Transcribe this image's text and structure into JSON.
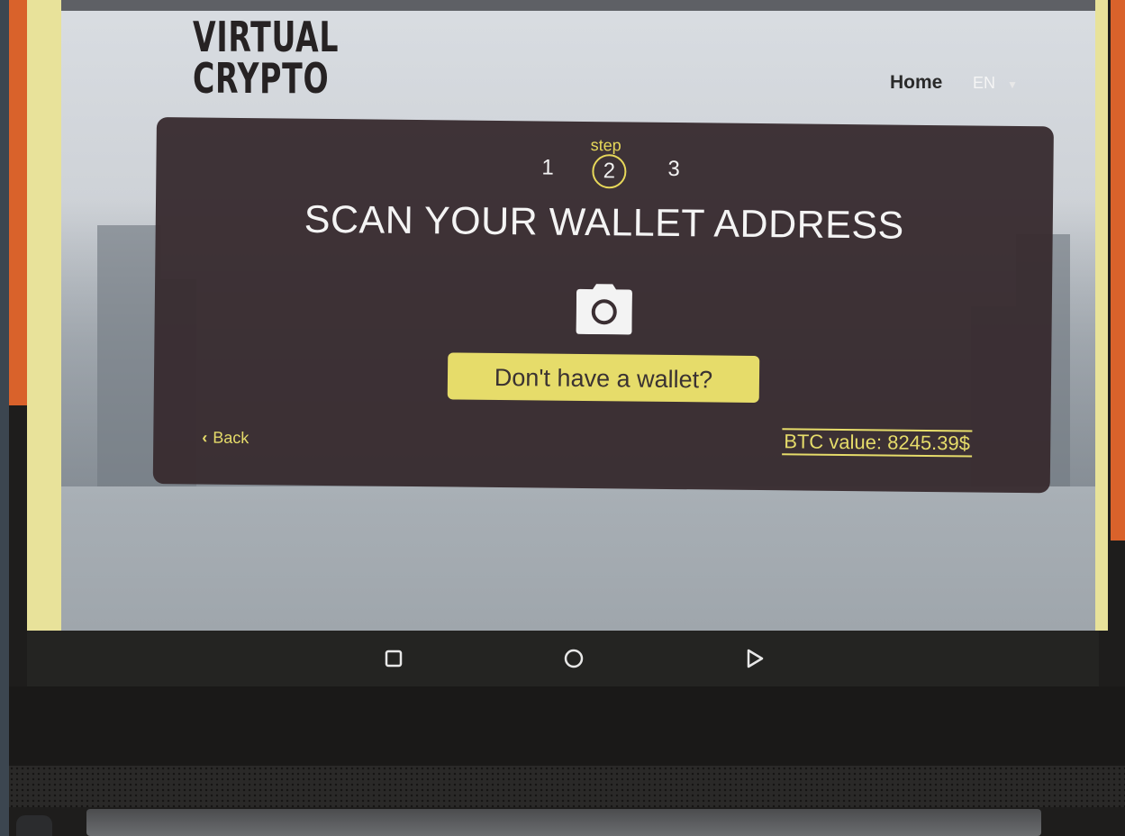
{
  "brand": {
    "logo_line1": "VIRTUAL",
    "logo_line2": "CRYPTO"
  },
  "nav": {
    "home_label": "Home",
    "language": "EN"
  },
  "steps": {
    "label": "step",
    "items": [
      "1",
      "2",
      "3"
    ],
    "current": "2"
  },
  "main": {
    "title": "SCAN YOUR WALLET ADDRESS",
    "wallet_button_label": "Don't have a wallet?",
    "back_label": "Back",
    "btc_value": "BTC value: 8245.39$"
  },
  "icons": {
    "camera": "camera-icon",
    "back": "chevron-left-icon",
    "lang_dropdown": "caret-down-icon",
    "android_recents": "square-icon",
    "android_home": "circle-icon",
    "android_back": "triangle-icon"
  },
  "colors": {
    "accent": "#e6dc6a",
    "panel": "#382c30",
    "text_light": "#f4f4f4"
  }
}
